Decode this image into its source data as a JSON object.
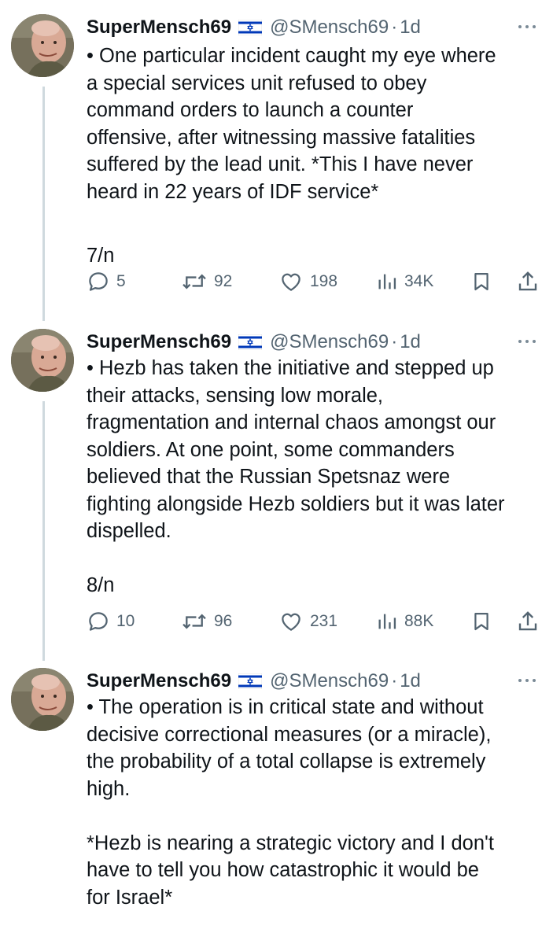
{
  "tweets": [
    {
      "name": "SuperMensch69",
      "flag": "israel-flag-icon",
      "handle": "@SMensch69",
      "sep": "·",
      "time": "1d",
      "lines": [
        "• One particular incident caught my eye where",
        "a special services unit refused to obey",
        "command orders to launch a counter",
        "offensive, after witnessing massive fatalities",
        "suffered by the lead unit. *This I have never",
        "heard in 22 years of IDF service*"
      ],
      "counter": "7/n",
      "replies": "5",
      "reposts": "92",
      "likes": "198",
      "views": "34K"
    },
    {
      "name": "SuperMensch69",
      "flag": "israel-flag-icon",
      "handle": "@SMensch69",
      "sep": "·",
      "time": "1d",
      "lines": [
        "• Hezb has taken the initiative and stepped up",
        "their attacks, sensing low morale,",
        "fragmentation and internal chaos amongst our",
        "soldiers. At one point, some commanders",
        "believed that the Russian Spetsnaz were",
        "fighting alongside Hezb soldiers but it was later",
        "dispelled."
      ],
      "counter": "8/n",
      "replies": "10",
      "reposts": "96",
      "likes": "231",
      "views": "88K"
    },
    {
      "name": "SuperMensch69",
      "flag": "israel-flag-icon",
      "handle": "@SMensch69",
      "sep": "·",
      "time": "1d",
      "lines": [
        "• The operation is in critical state and without",
        "decisive correctional measures (or a miracle),",
        "the probability of a total collapse is extremely",
        "high."
      ],
      "lines2": [
        "*Hezb is nearing a strategic victory and I don't",
        "have to tell you how catastrophic it would be",
        "for Israel*"
      ]
    }
  ],
  "colors": {
    "text": "#0f1419",
    "muted": "#536471",
    "thread_line": "#cfd9de",
    "flag_blue": "#0038b8"
  }
}
